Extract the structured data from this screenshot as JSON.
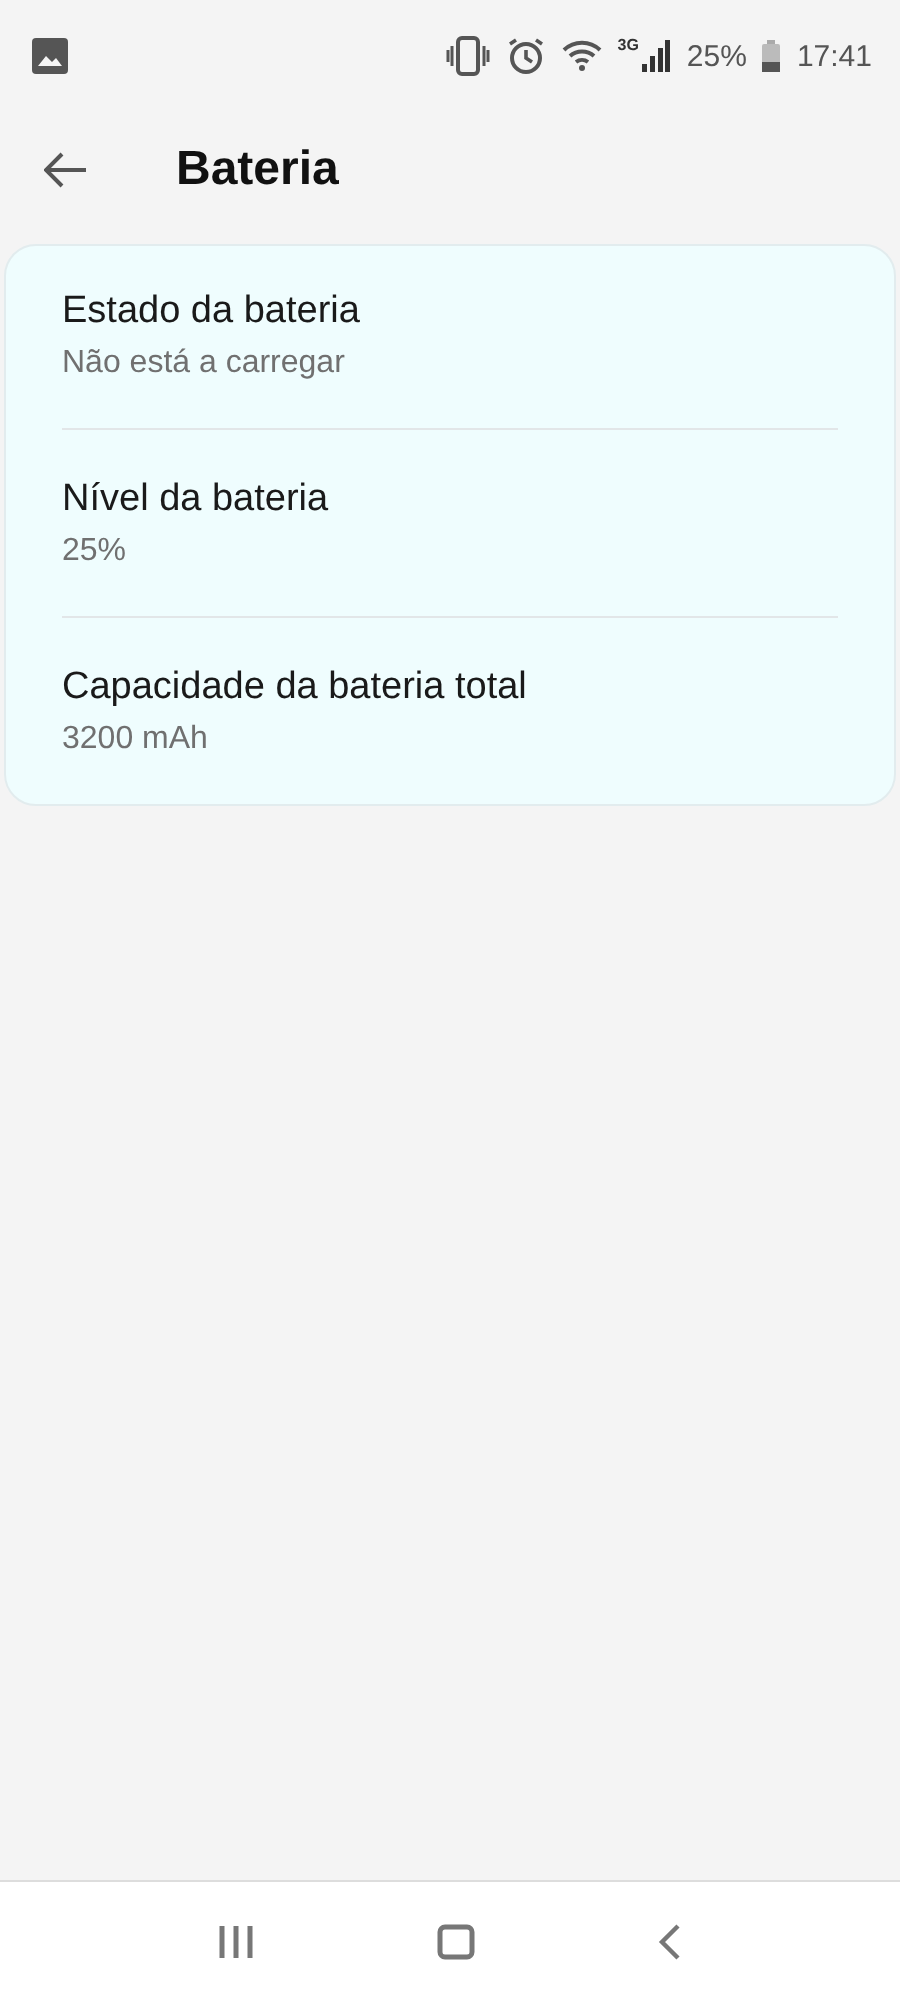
{
  "status_bar": {
    "network": "3G",
    "battery": "25%",
    "time": "17:41"
  },
  "header": {
    "title": "Bateria"
  },
  "items": [
    {
      "title": "Estado da bateria",
      "value": "Não está a carregar"
    },
    {
      "title": "Nível da bateria",
      "value": "25%"
    },
    {
      "title": "Capacidade da bateria total",
      "value": "3200 mAh"
    }
  ]
}
